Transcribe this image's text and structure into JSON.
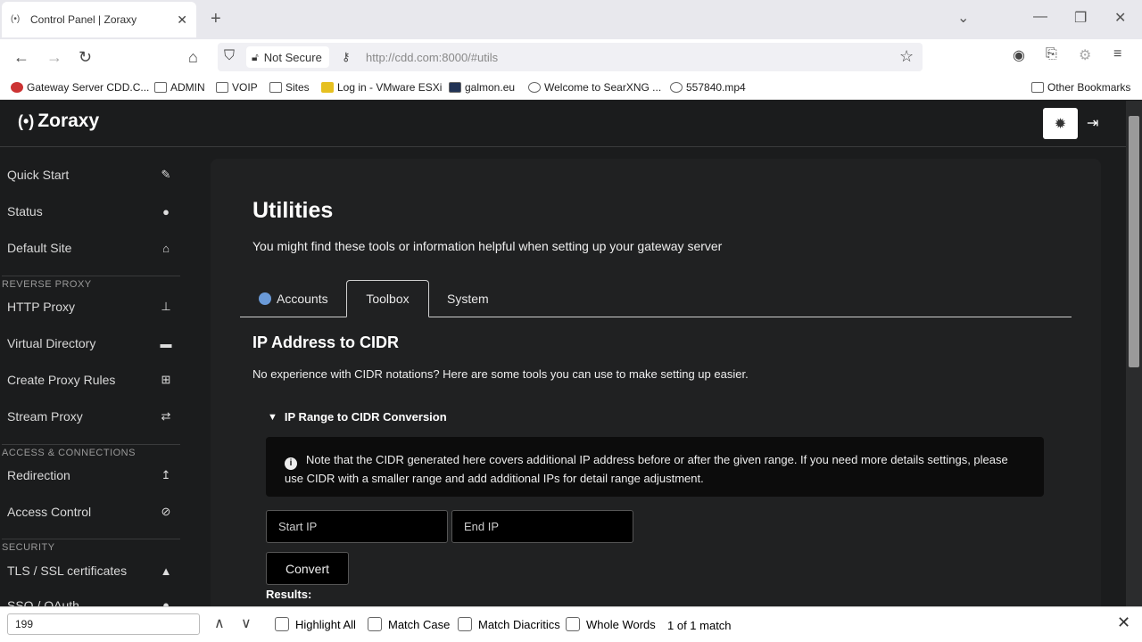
{
  "browser": {
    "tab_title": "Control Panel | Zoraxy",
    "tab_favicon": "(•)",
    "not_secure_label": "Not Secure",
    "url": "http://cdd.com:8000/#utils",
    "bookmarks": [
      {
        "label": "Gateway Server CDD.C..."
      },
      {
        "label": "ADMIN"
      },
      {
        "label": "VOIP"
      },
      {
        "label": "Sites"
      },
      {
        "label": "Log in - VMware ESXi"
      },
      {
        "label": "galmon.eu"
      },
      {
        "label": "Welcome to SearXNG ..."
      },
      {
        "label": "557840.mp4"
      }
    ],
    "other_bookmarks": "Other Bookmarks"
  },
  "app": {
    "logo_text": "Zoraxy",
    "logo_icon": "(•)"
  },
  "sidebar": {
    "items": [
      {
        "label": "Quick Start",
        "icon": "✎"
      },
      {
        "label": "Status",
        "icon": "●"
      },
      {
        "label": "Default Site",
        "icon": "⌂"
      },
      {
        "label": "HTTP Proxy",
        "icon": "⊥"
      },
      {
        "label": "Virtual Directory",
        "icon": "▬"
      },
      {
        "label": "Create Proxy Rules",
        "icon": "⊞"
      },
      {
        "label": "Stream Proxy",
        "icon": "⇄"
      },
      {
        "label": "Redirection",
        "icon": "↥"
      },
      {
        "label": "Access Control",
        "icon": "⊘"
      },
      {
        "label": "TLS / SSL certificates",
        "icon": "▲"
      },
      {
        "label": "SSO / OAuth",
        "icon": "●"
      }
    ],
    "headers": [
      "REVERSE PROXY",
      "ACCESS & CONNECTIONS",
      "SECURITY"
    ]
  },
  "main": {
    "title": "Utilities",
    "description": "You might find these tools or information helpful when setting up your gateway server",
    "tabs": [
      {
        "label": "Accounts"
      },
      {
        "label": "Toolbox"
      },
      {
        "label": "System"
      }
    ],
    "section_title": "IP Address to CIDR",
    "section_description": "No experience with CIDR notations? Here are some tools you can use to make setting up easier.",
    "accordion_title": "IP Range to CIDR Conversion",
    "note": "Note that the CIDR generated here covers additional IP address before or after the given range. If you need more details settings, please use CIDR with a smaller range and add additional IPs for detail range adjustment.",
    "start_ip_placeholder": "Start IP",
    "end_ip_placeholder": "End IP",
    "convert_label": "Convert",
    "results_label": "Results:"
  },
  "findbar": {
    "query": "199",
    "highlight_all": "Highlight All",
    "match_case": "Match Case",
    "match_diacritics": "Match Diacritics",
    "whole_words": "Whole Words",
    "count": "1 of 1 match"
  }
}
